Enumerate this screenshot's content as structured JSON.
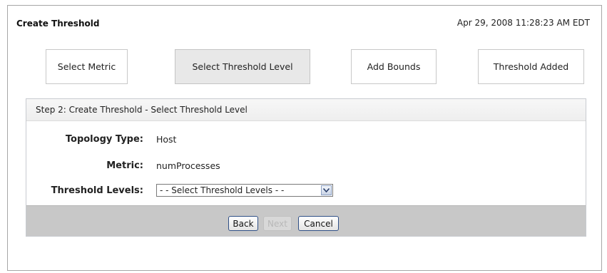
{
  "header": {
    "title": "Create Threshold",
    "timestamp": "Apr 29, 2008 11:28:23 AM EDT"
  },
  "steps": [
    {
      "label": "Select Metric",
      "active": false
    },
    {
      "label": "Select Threshold Level",
      "active": true
    },
    {
      "label": "Add Bounds",
      "active": false
    },
    {
      "label": "Threshold Added",
      "active": false
    }
  ],
  "form": {
    "heading": "Step 2: Create Threshold - Select Threshold Level",
    "topology_type": {
      "label": "Topology Type:",
      "value": "Host"
    },
    "metric": {
      "label": "Metric:",
      "value": "numProcesses"
    },
    "threshold_levels": {
      "label": "Threshold Levels:",
      "selected": "- - Select Threshold Levels - -"
    }
  },
  "buttons": {
    "back": "Back",
    "next": "Next",
    "cancel": "Cancel"
  },
  "colors": {
    "active_step_bg": "#e8e8e8",
    "footer_bg": "#c8c8c8",
    "button_border": "#2f4f86"
  }
}
